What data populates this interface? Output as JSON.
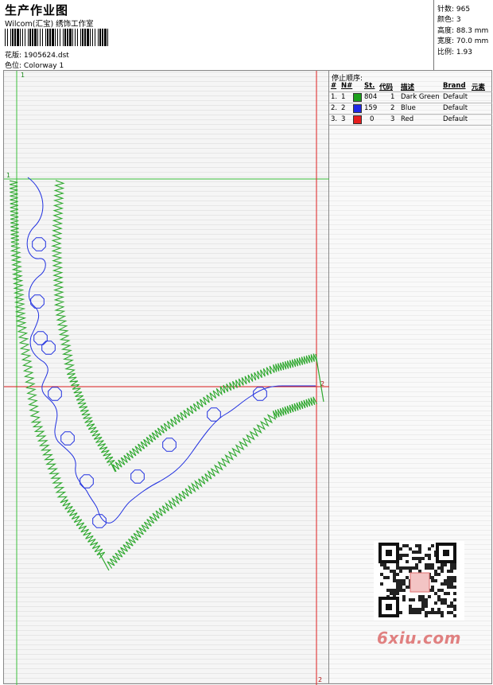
{
  "header": {
    "title": "生产作业图",
    "company": "Wilcom(汇宝) 绣饰工作室",
    "file_label": "花版:",
    "file_value": "1905624.dst",
    "color_label": "色位:",
    "color_value": "Colorway 1"
  },
  "stats": {
    "stitches": "针数: 965",
    "colors": "颜色: 3",
    "height": "高度: 88.3 mm",
    "width": "宽度: 70.0 mm",
    "ratio": "比例: 1.93"
  },
  "stop_sequence": {
    "title": "停止顺序:",
    "headers": [
      "#",
      "N#",
      "St.",
      "代码",
      "描述",
      "Brand",
      "元素"
    ],
    "rows": [
      {
        "index": "1.",
        "n": "1",
        "color": "#1ca01c",
        "stitches": "804",
        "code": "1",
        "desc": "Dark Green",
        "brand": "Default"
      },
      {
        "index": "2.",
        "n": "2",
        "color": "#1e28e6",
        "stitches": "159",
        "code": "2",
        "desc": "Blue",
        "brand": "Default"
      },
      {
        "index": "3.",
        "n": "3",
        "color": "#e61e1e",
        "stitches": "0",
        "code": "3",
        "desc": "Red",
        "brand": "Default"
      }
    ]
  },
  "guides": {
    "v1": "1",
    "h1": "1",
    "h2": "2",
    "v2": "2"
  },
  "watermark": "6xiu.com",
  "colors": {
    "green": "#2ea82e",
    "blue": "#2030e0",
    "guide_green": "#3ac03a",
    "guide_red": "#e02020"
  }
}
